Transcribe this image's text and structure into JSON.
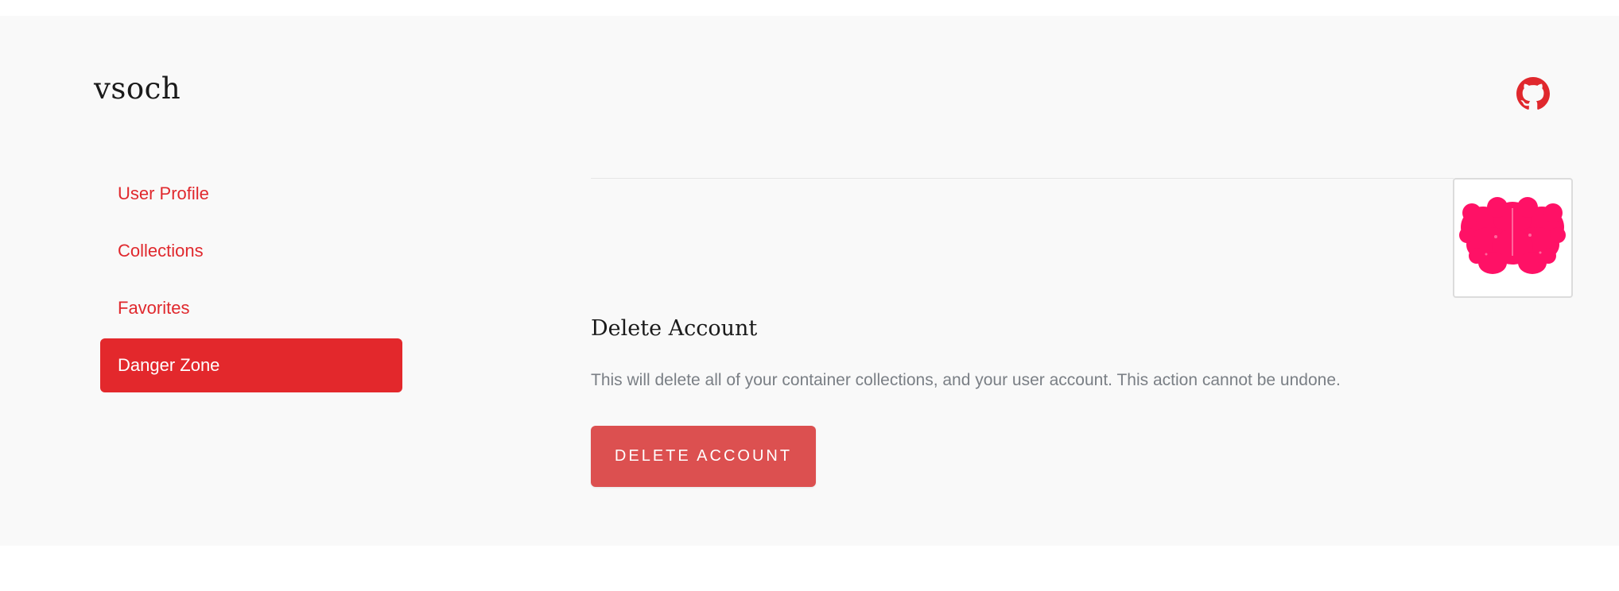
{
  "brand": {
    "title": "vsoch"
  },
  "header": {
    "github_icon": "github-icon"
  },
  "sidebar": {
    "items": [
      {
        "label": "User Profile",
        "active": false
      },
      {
        "label": "Collections",
        "active": false
      },
      {
        "label": "Favorites",
        "active": false
      },
      {
        "label": "Danger Zone",
        "active": true
      }
    ]
  },
  "main": {
    "section_title": "Delete Account",
    "section_description": "This will delete all of your container collections, and your user account. This action cannot be undone.",
    "delete_button_label": "DELETE ACCOUNT"
  },
  "colors": {
    "accent": "#e3282c",
    "danger_button": "#dc5050",
    "avatar": "#ff1166",
    "background": "#f9f9f9"
  }
}
